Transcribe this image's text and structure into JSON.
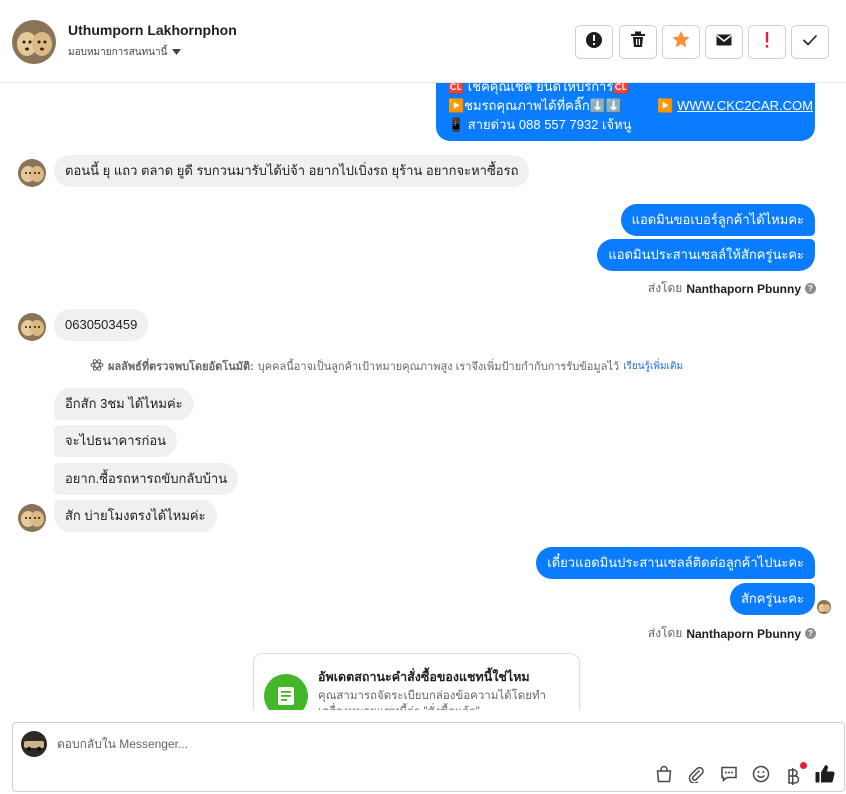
{
  "header": {
    "name": "Uthumporn Lakhornphon",
    "assign_label": "มอบหมายการสนทนานี้"
  },
  "messages": {
    "top_card_line1": "🆑 เช็คคุณเช็ค ยินดีให้บริการ🆑",
    "top_card_line2_text": "▶️ชมรถคุณภาพได้ที่คลิ๊ก⬇️⬇️",
    "top_card_line2_link": "WWW.CKC2CAR.COM",
    "top_card_line3": "📱 สายด่วน 088 557 7932 เจ้หนู",
    "m1": "ตอนนี้ ยุ แถว ตลาด ยูดี รบกวนมารับได้บ่จ้า อยากไปเบิ่งรถ ยุร้าน อยากจะหาซื้อรถ",
    "m2": "แอดมินขอเบอร์ลูกค้าได้ไหมคะ",
    "m3": "แอดมินประสานเซลล์ให้สักครู่นะคะ",
    "sent_by_prefix": "ส่งโดย",
    "sent_by_name": "Nanthaporn Pbunny",
    "m4": "0630503459",
    "ai_bold": "ผลลัพธ์ที่ตรวจพบโดยอัตโนมัติ:",
    "ai_text": "บุคคลนี้อาจเป็นลูกค้าเป้าหมายคุณภาพสูง เราจึงเพิ่มป้ายกำกับการรับข้อมูลไว้",
    "ai_link": "เรียนรู้เพิ่มเติม",
    "m5": "อีกสัก 3ชม ได้ไหมค่ะ",
    "m6": "จะไปธนาคารก่อน",
    "m7": "อยาก.ซื้อรถหารถขับกลับบ้าน",
    "m8": "สัก บ่ายโมงตรงได้ไหมค่ะ",
    "m9": "เดี๋ยวแอดมินประสานเซลล์ติดต่อลูกค้าไปนะคะ",
    "m10": "สักครู่นะคะ"
  },
  "card": {
    "title": "อัพเดตสถานะคำสั่งซื้อของแชทนี้ใช่ไหม",
    "desc": "คุณสามารถจัดระเบียบกล่องข้อความได้โดยทำเครื่องหมายแชทนี้ว่า \"สั่งซื้อแล้ว\""
  },
  "composer": {
    "placeholder": "ตอบกลับใน Messenger..."
  },
  "colors": {
    "outgoing": "#0a7cff",
    "incoming": "#f0f0f0",
    "star": "#f7923a",
    "alert": "#e41e3f",
    "card_icon": "#42b72a"
  },
  "icons": [
    "exclamation-circle-icon",
    "trash-icon",
    "star-icon",
    "envelope-icon",
    "exclamation-icon",
    "check-icon",
    "shopping-bag-icon",
    "paperclip-icon",
    "chat-icon",
    "emoji-icon",
    "baht-icon",
    "thumbs-up-icon"
  ]
}
